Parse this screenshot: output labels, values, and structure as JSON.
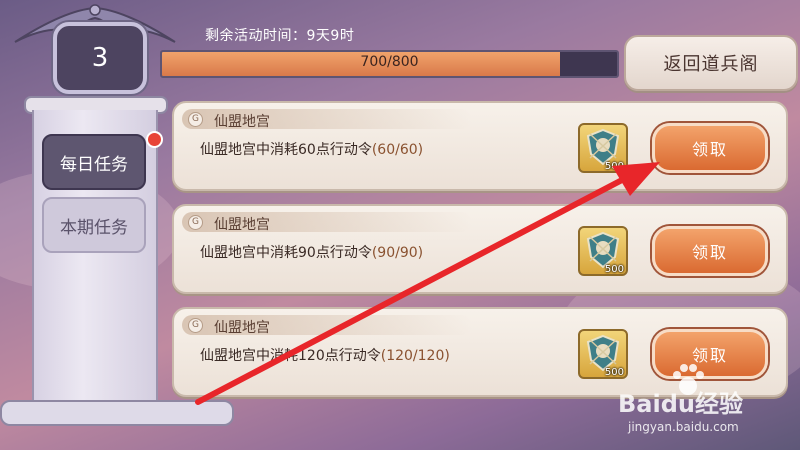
{
  "level": "3",
  "event_timer": "剩余活动时间：9天9时",
  "progress": {
    "text": "700/800",
    "current": 700,
    "max": 800
  },
  "return_button": "返回道兵阁",
  "tabs": [
    {
      "label": "每日任务",
      "active": true,
      "has_notification": true
    },
    {
      "label": "本期任务",
      "active": false
    }
  ],
  "tasks": [
    {
      "title": "仙盟地宫",
      "desc": "仙盟地宫中消耗60点行动令",
      "progress": "(60/60)",
      "reward_count": "500",
      "claim_label": "领取"
    },
    {
      "title": "仙盟地宫",
      "desc": "仙盟地宫中消耗90点行动令",
      "progress": "(90/90)",
      "reward_count": "500",
      "claim_label": "领取"
    },
    {
      "title": "仙盟地宫",
      "desc": "仙盟地宫中消耗120点行动令",
      "progress": "(120/120)",
      "reward_count": "500",
      "claim_label": "领取"
    }
  ],
  "watermark": {
    "logo": "Baidu经验",
    "url": "jingyan.baidu.com"
  },
  "colors": {
    "accent": "#da6a31",
    "panel": "#5e5670",
    "notification": "#e84438"
  }
}
